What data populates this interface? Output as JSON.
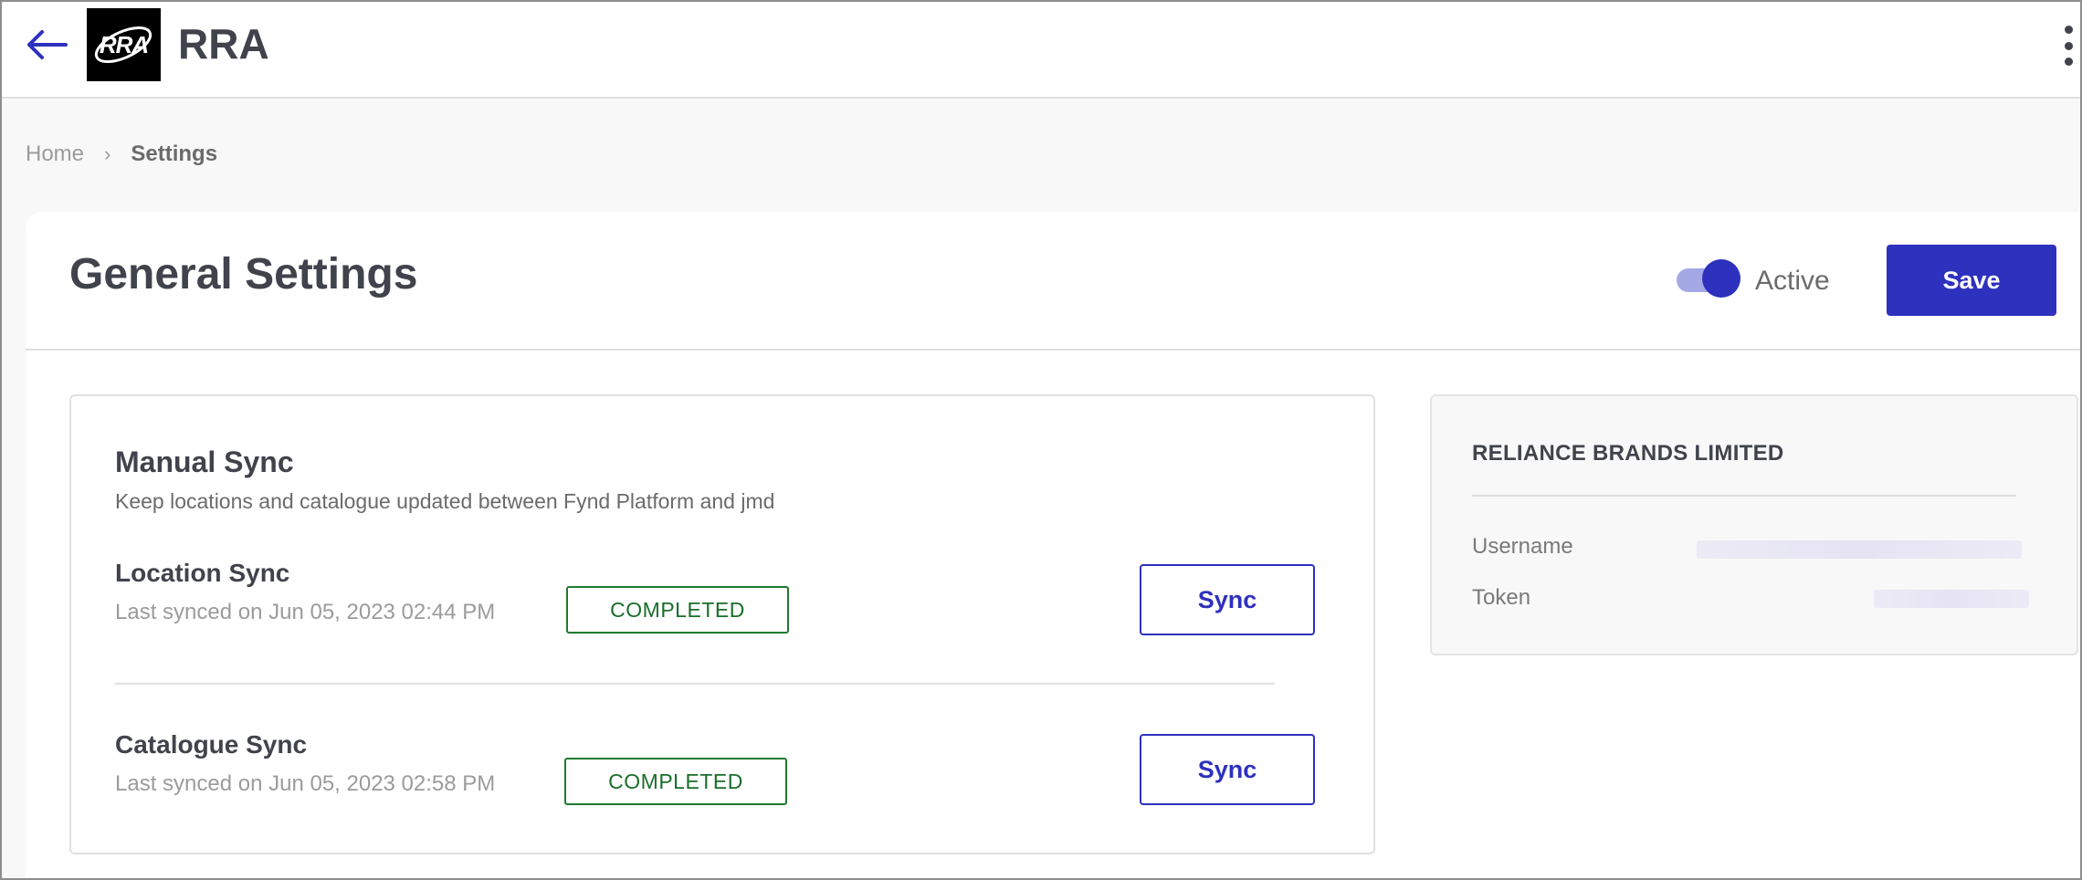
{
  "app": {
    "title": "RRA",
    "logo_text": "RRA"
  },
  "header": {
    "back_icon": "arrow-left-icon",
    "menu_icon": "kebab-vertical-icon"
  },
  "breadcrumb": {
    "home": "Home",
    "separator": "›",
    "current": "Settings"
  },
  "page": {
    "title": "General Settings",
    "status_toggle": {
      "label": "Active",
      "on": true
    },
    "save_label": "Save"
  },
  "manual_sync": {
    "title": "Manual Sync",
    "description": "Keep locations and catalogue updated between Fynd Platform and jmd",
    "rows": [
      {
        "title": "Location Sync",
        "last_synced": "Last synced on Jun 05, 2023 02:44 PM",
        "status": "COMPLETED",
        "action": "Sync"
      },
      {
        "title": "Catalogue Sync",
        "last_synced": "Last synced on Jun 05, 2023 02:58 PM",
        "status": "COMPLETED",
        "action": "Sync"
      }
    ]
  },
  "account": {
    "company": "RELIANCE BRANDS LIMITED",
    "username_label": "Username",
    "token_label": "Token"
  },
  "colors": {
    "primary": "#2e31be",
    "toggle_track": "#a4a9e6",
    "success": "#1f7a2f",
    "text": "#41434c",
    "muted": "#9b9b9b"
  }
}
